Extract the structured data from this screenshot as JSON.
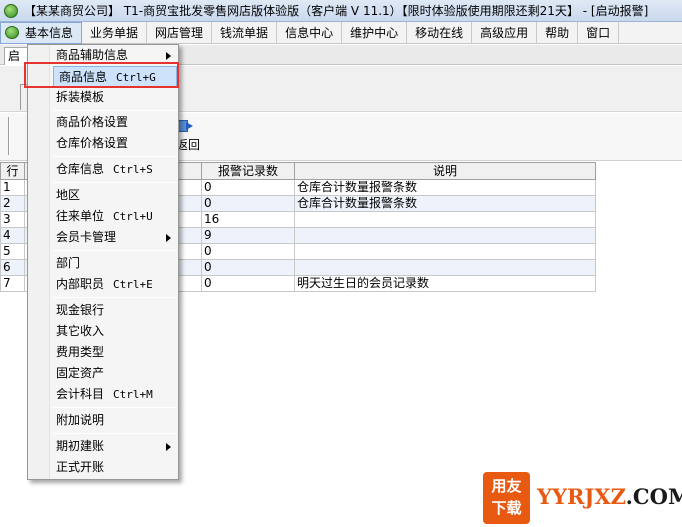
{
  "window": {
    "title": "【某某商贸公司】 T1-商贸宝批发零售网店版体验版（客户端 V 11.1）【限时体验版使用期限还剩21天】 - [启动报警]"
  },
  "menubar": {
    "items": [
      "基本信息",
      "业务单据",
      "网店管理",
      "钱流单据",
      "信息中心",
      "维护中心",
      "移动在线",
      "高级应用",
      "帮助",
      "窗口"
    ]
  },
  "tabs": [
    "启"
  ],
  "toolbar": {
    "back_label": "返回"
  },
  "grid": {
    "headers": [
      "行",
      "",
      "报警记录数",
      "说明"
    ],
    "rows": [
      [
        "1",
        "",
        "0",
        "仓库合计数量报警条数"
      ],
      [
        "2",
        "",
        "0",
        "仓库合计数量报警条数"
      ],
      [
        "3",
        "",
        "16",
        ""
      ],
      [
        "4",
        "",
        "9",
        ""
      ],
      [
        "5",
        "",
        "0",
        ""
      ],
      [
        "6",
        "",
        "0",
        ""
      ],
      [
        "7",
        "",
        "0",
        "明天过生日的会员记录数"
      ]
    ]
  },
  "dropdown": {
    "items": [
      {
        "label": "商品辅助信息",
        "shortcut": "",
        "submenu": true
      },
      {
        "label": "商品信息",
        "shortcut": "Ctrl+G",
        "submenu": false
      },
      {
        "label": "拆装模板",
        "shortcut": "",
        "submenu": false
      },
      {
        "label": "商品价格设置",
        "shortcut": "",
        "submenu": false
      },
      {
        "label": "仓库价格设置",
        "shortcut": "",
        "submenu": false
      },
      {
        "label": "仓库信息",
        "shortcut": "Ctrl+S",
        "submenu": false
      },
      {
        "label": "地区",
        "shortcut": "",
        "submenu": false
      },
      {
        "label": "往来单位",
        "shortcut": "Ctrl+U",
        "submenu": false
      },
      {
        "label": "会员卡管理",
        "shortcut": "",
        "submenu": true
      },
      {
        "label": "部门",
        "shortcut": "",
        "submenu": false
      },
      {
        "label": "内部职员",
        "shortcut": "Ctrl+E",
        "submenu": false
      },
      {
        "label": "现金银行",
        "shortcut": "",
        "submenu": false
      },
      {
        "label": "其它收入",
        "shortcut": "",
        "submenu": false
      },
      {
        "label": "费用类型",
        "shortcut": "",
        "submenu": false
      },
      {
        "label": "固定资产",
        "shortcut": "",
        "submenu": false
      },
      {
        "label": "会计科目",
        "shortcut": "Ctrl+M",
        "submenu": false
      },
      {
        "label": "附加说明",
        "shortcut": "",
        "submenu": false
      },
      {
        "label": "期初建账",
        "shortcut": "",
        "submenu": true
      },
      {
        "label": "正式开账",
        "shortcut": "",
        "submenu": false
      }
    ],
    "selected": "商品信息"
  },
  "watermark": {
    "badge_line1": "用友",
    "badge_line2": "下载",
    "domain_head": "YYRJXZ",
    "domain_tail": ".COM"
  },
  "colors": {
    "highlight": "#e8322e",
    "watermark": "#e85a12",
    "selection": "#cde2fb"
  }
}
